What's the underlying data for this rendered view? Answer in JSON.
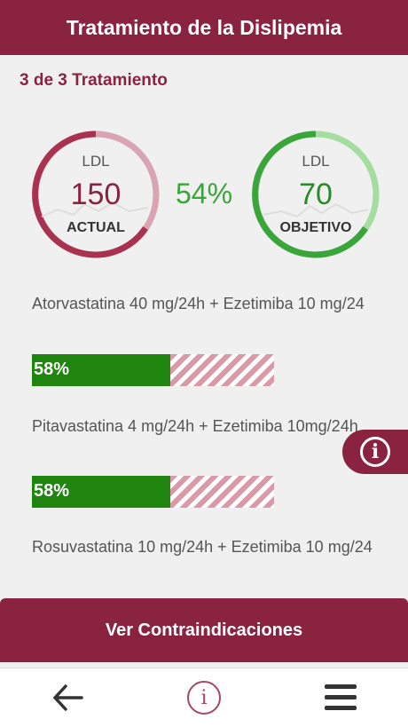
{
  "header": {
    "title": "Tratamiento de la Dislipemia"
  },
  "step": {
    "label": "3 de 3 Tratamiento"
  },
  "ldl": {
    "actual": {
      "label": "LDL",
      "value": "150",
      "caption": "ACTUAL",
      "color": "#8a2340"
    },
    "objetivo": {
      "label": "LDL",
      "value": "70",
      "caption": "OBJETIVO",
      "color": "#2a8a2a"
    },
    "reduction": "54%"
  },
  "treatments": [
    {
      "name": "Atorvastatina 40 mg/24h + Ezetimiba 10 mg/24",
      "percent": "58%",
      "fraction": 0.57
    },
    {
      "name": "Pitavastatina 4 mg/24h + Ezetimiba 10mg/24h",
      "percent": "58%",
      "fraction": 0.57
    },
    {
      "name": "Rosuvastatina 10 mg/24h + Ezetimiba 10 mg/24"
    }
  ],
  "cta": {
    "label": "Ver Contraindicaciones"
  },
  "side_tab": {
    "icon": "info-icon",
    "glyph": "i"
  },
  "nav": {
    "back_icon": "arrow-left-icon",
    "info_icon": "info-icon",
    "info_glyph": "i",
    "menu_icon": "menu-icon"
  },
  "colors": {
    "brand": "#8a2340",
    "success": "#1f850f",
    "stripe": "#d99aa8"
  }
}
